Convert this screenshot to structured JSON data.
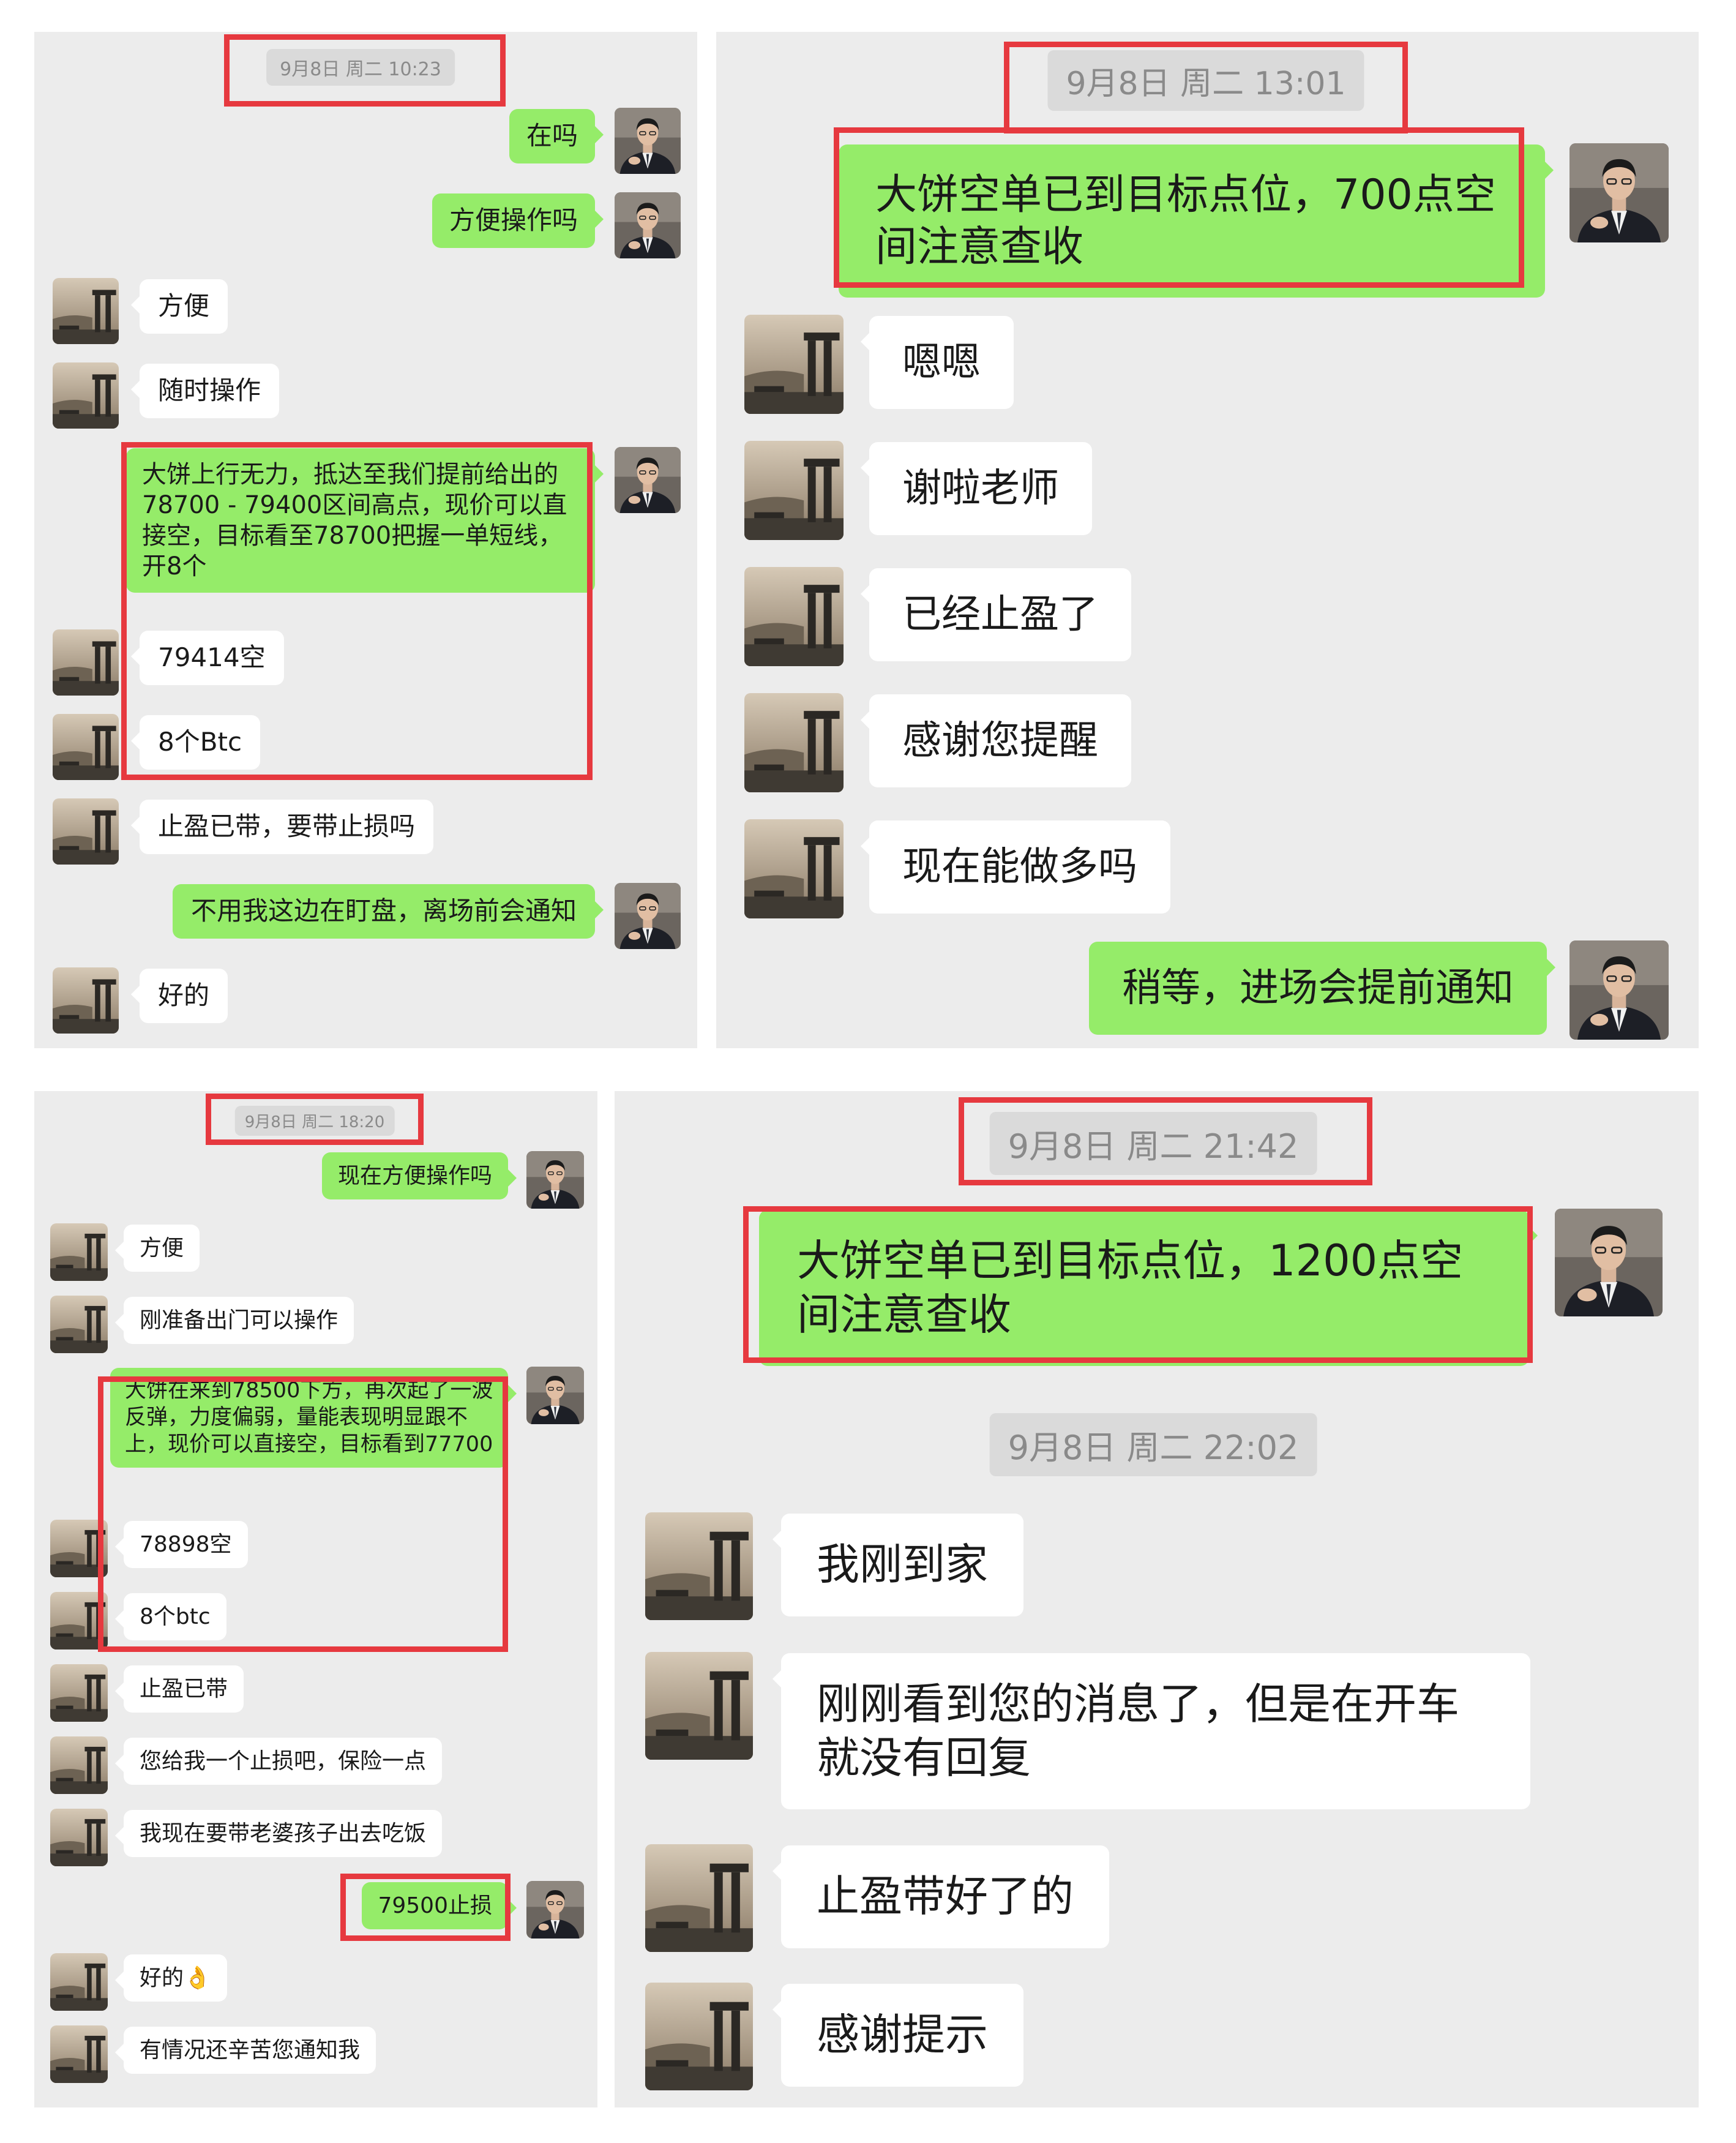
{
  "panels": {
    "p1": {
      "time": "9月8日 周二 10:23",
      "messages": [
        "在吗",
        "方便操作吗",
        "方便",
        "随时操作",
        "大饼上行无力，抵达至我们提前给出的 78700 - 79400区间高点，现价可以直接空，目标看至78700把握一单短线，开8个",
        "79414空",
        "8个Btc",
        "止盈已带，要带止损吗",
        "不用我这边在盯盘，离场前会通知",
        "好的"
      ]
    },
    "p2": {
      "time": "9月8日 周二 13:01",
      "messages": [
        "大饼空单已到目标点位，700点空间注意查收",
        "嗯嗯",
        "谢啦老师",
        "已经止盈了",
        "感谢您提醒",
        "现在能做多吗",
        "稍等，进场会提前通知"
      ]
    },
    "p3": {
      "time": "9月8日 周二 18:20",
      "messages": [
        "现在方便操作吗",
        "方便",
        "刚准备出门可以操作",
        "大饼在来到78500下方，再次起了一波反弹，力度偏弱，量能表现明显跟不上，现价可以直接空，目标看到77700",
        "78898空",
        "8个btc",
        "止盈已带",
        "您给我一个止损吧，保险一点",
        "我现在要带老婆孩子出去吃饭",
        "79500止损",
        "好的👌",
        "有情况还辛苦您通知我"
      ]
    },
    "p4": {
      "time1": "9月8日 周二 21:42",
      "time2": "9月8日 周二 22:02",
      "messages": [
        "大饼空单已到目标点位，1200点空间注意查收",
        "我刚到家",
        "刚刚看到您的消息了，但是在开车就没有回复",
        "止盈带好了的",
        "感谢提示"
      ]
    }
  },
  "colors": {
    "sent_bubble": "#95ec69",
    "received_bubble": "#ffffff",
    "highlight": "#e6393f",
    "background": "#ececec"
  },
  "icons": {
    "teacher": "avatar-man-in-suit",
    "client": "avatar-landscape-columns"
  }
}
